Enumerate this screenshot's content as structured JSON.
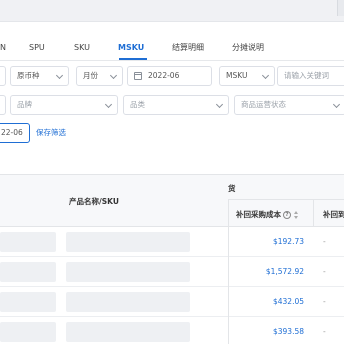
{
  "tabs": [
    {
      "label": "N",
      "active": false
    },
    {
      "label": "SPU",
      "active": false
    },
    {
      "label": "SKU",
      "active": false
    },
    {
      "label": "MSKU",
      "active": true
    },
    {
      "label": "结算明细",
      "active": false
    },
    {
      "label": "分摊说明",
      "active": false
    }
  ],
  "filters_row1": {
    "field0": "",
    "currency": "原币种",
    "period_type": "月份",
    "month": "2022-06",
    "dimension": "MSKU",
    "keyword_placeholder": "请输入关键词"
  },
  "filters_row2": {
    "field0": "",
    "brand": "品牌",
    "category": "品类",
    "status": "商品运营状态"
  },
  "filters_row3": {
    "month_short": "22-06",
    "save_filter": "保存筛选"
  },
  "table": {
    "group_header": "货",
    "col_product": "产品名称/SKU",
    "col_refund_cost": "补回采购成本",
    "col_next": "补回到"
  },
  "rows": [
    {
      "refund_cost": "$192.73"
    },
    {
      "refund_cost": "$1,572.92"
    },
    {
      "refund_cost": "$432.05"
    },
    {
      "refund_cost": "$393.58"
    }
  ],
  "colors": {
    "accent": "#1f6ed4"
  }
}
